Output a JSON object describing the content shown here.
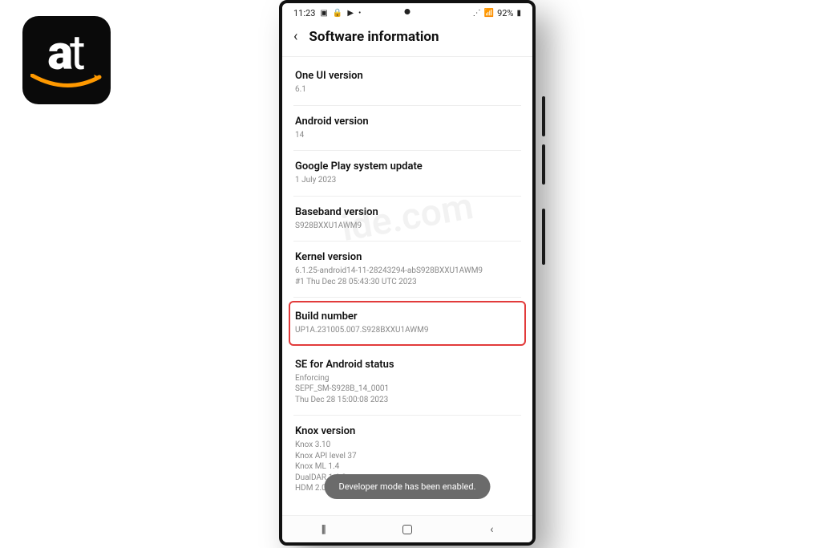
{
  "logo": {
    "text_a": "a",
    "text_t": "t"
  },
  "status": {
    "time": "11:23",
    "battery": "92%"
  },
  "header": {
    "title": "Software information"
  },
  "items": [
    {
      "label": "One UI version",
      "value": "6.1"
    },
    {
      "label": "Android version",
      "value": "14"
    },
    {
      "label": "Google Play system update",
      "value": "1 July 2023"
    },
    {
      "label": "Baseband version",
      "value": "S928BXXU1AWM9"
    },
    {
      "label": "Kernel version",
      "value": "6.1.25-android14-11-28243294-abS928BXXU1AWM9\n#1 Thu Dec 28 05:43:30 UTC 2023"
    },
    {
      "label": "Build number",
      "value": "UP1A.231005.007.S928BXXU1AWM9",
      "highlight": true
    },
    {
      "label": "SE for Android status",
      "value": "Enforcing\nSEPF_SM-S928B_14_0001\nThu Dec 28 15:00:08 2023"
    },
    {
      "label": "Knox version",
      "value": "Knox 3.10\nKnox API level 37\nKnox ML 1.4\nDualDAR 1.6.0\nHDM 2.0 - 1D"
    }
  ],
  "toast": "Developer mode has been enabled.",
  "watermark": "ide.com"
}
